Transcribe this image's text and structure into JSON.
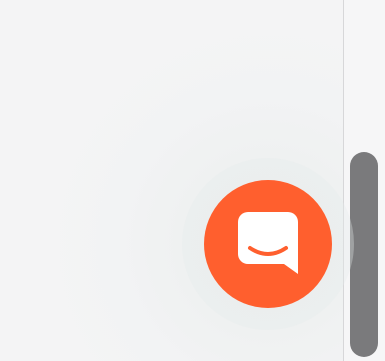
{
  "chat_launcher": {
    "icon": "chat-bubble-smile-icon",
    "color": "#ff5f2e",
    "icon_color": "#ffffff"
  },
  "scrollbar": {
    "thumb_color": "#7a7a7c",
    "track_color": "#f6f6f7",
    "position": 0.98
  },
  "page": {
    "background": "#f4f4f5"
  }
}
